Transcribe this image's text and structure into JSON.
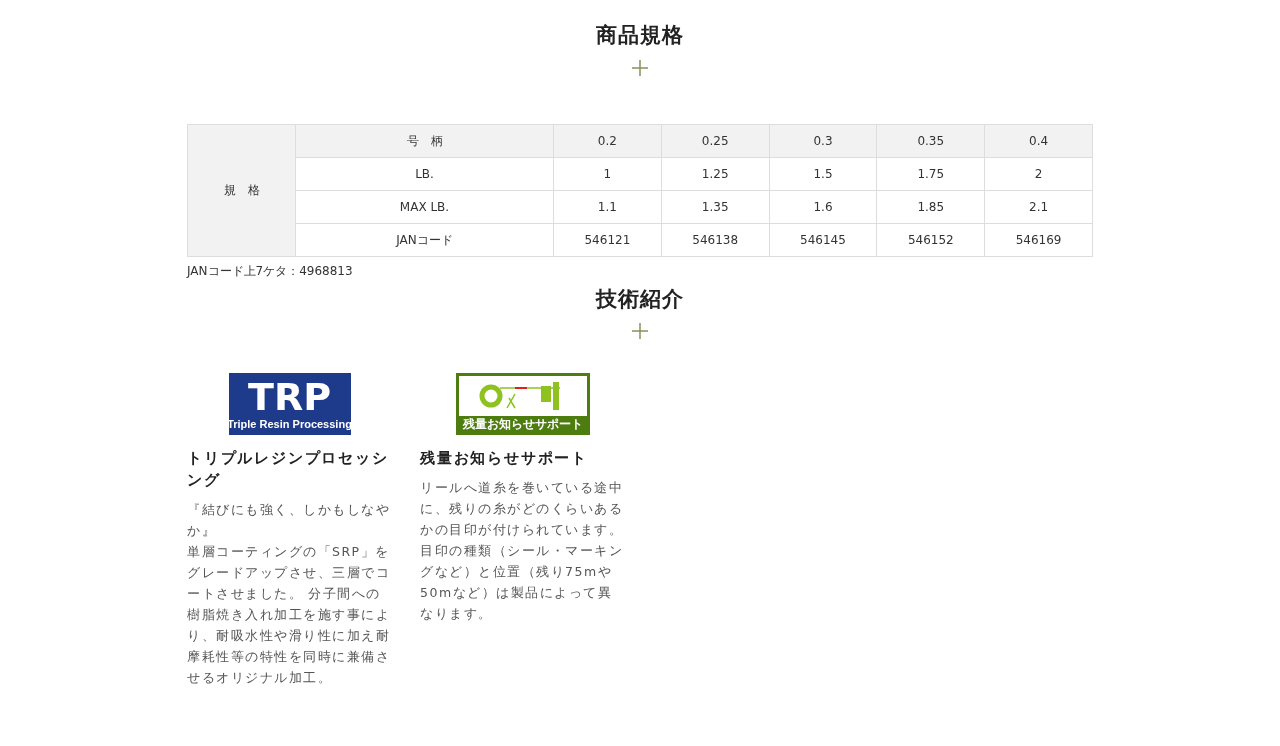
{
  "spec_section": {
    "title": "商品規格",
    "table": {
      "group_label": "規　格",
      "rows": [
        {
          "label": "号　柄",
          "values": [
            "0.2",
            "0.25",
            "0.3",
            "0.35",
            "0.4"
          ],
          "header": true
        },
        {
          "label": "LB.",
          "values": [
            "1",
            "1.25",
            "1.5",
            "1.75",
            "2"
          ],
          "header": false
        },
        {
          "label": "MAX LB.",
          "values": [
            "1.1",
            "1.35",
            "1.6",
            "1.85",
            "2.1"
          ],
          "header": false
        },
        {
          "label": "JANコード",
          "values": [
            "546121",
            "546138",
            "546145",
            "546152",
            "546169"
          ],
          "header": false
        }
      ]
    },
    "note": "JANコード上7ケタ：4968813"
  },
  "tech_section": {
    "title": "技術紹介",
    "features": [
      {
        "kind": "trp",
        "logo_text": "TRP",
        "logo_subtext": "Triple Resin Processing",
        "title": "トリプルレジンプロセッシング",
        "paragraphs": [
          "『結びにも強く、しかもしなやか』",
          "単層コーティングの「SRP」をグレードアップさせ、三層でコートさせました。 分子間への樹脂焼き入れ加工を施す事により、耐吸水性や滑り性に加え耐摩耗性等の特性を同時に兼備させるオリジナル加工。"
        ]
      },
      {
        "kind": "remain",
        "logo_subtext": "残量お知らせサポート",
        "title": "残量お知らせサポート",
        "paragraphs": [
          "リールへ道糸を巻いている途中に、残りの糸がどのくらいあるかの目印が付けられています。目印の種類（シール・マーキングなど）と位置（残り75mや50mなど）は製品によって異なります。"
        ]
      }
    ]
  }
}
